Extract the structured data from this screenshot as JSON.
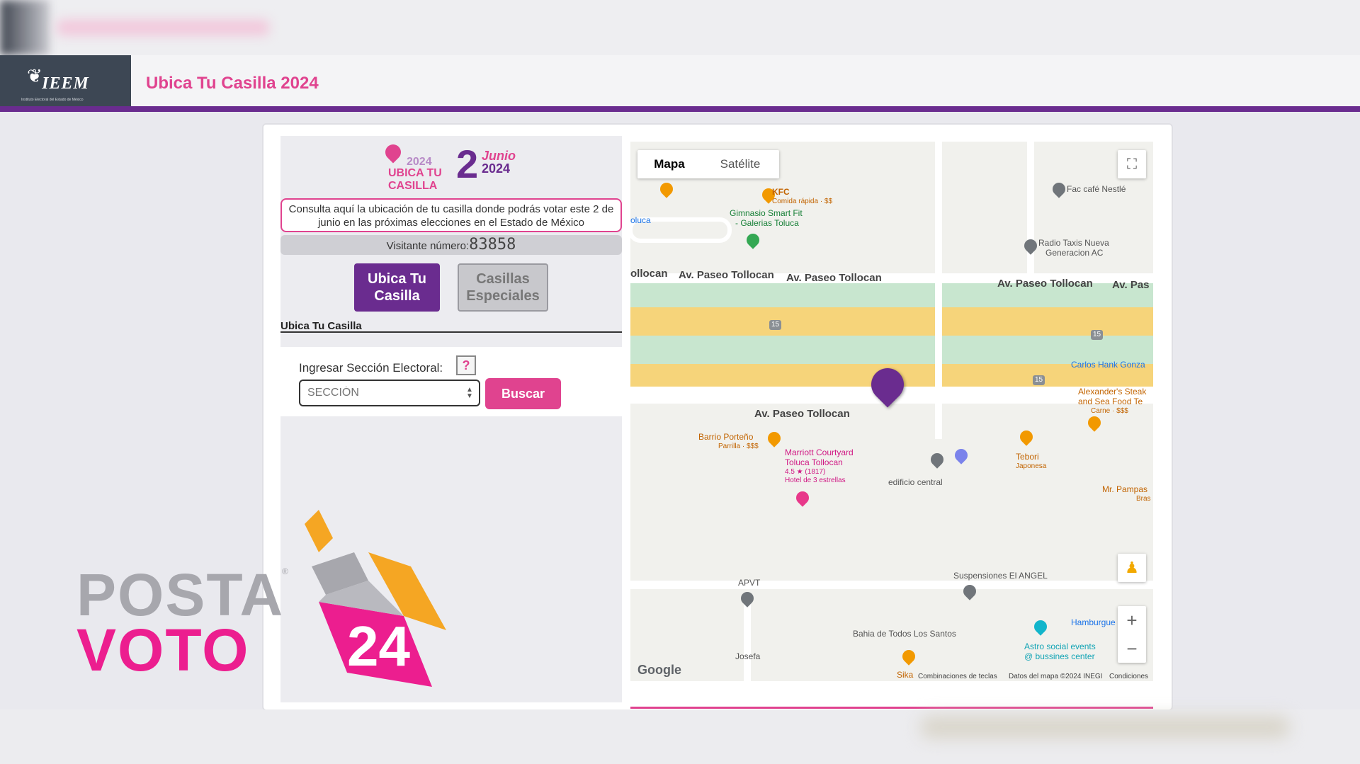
{
  "header": {
    "logo_text": "IEEM",
    "logo_subtitle": "Instituto Electoral del Estado de México",
    "title": "Ubica Tu Casilla 2024"
  },
  "brand": {
    "year": "2024",
    "line1": "UBICA TU",
    "line2": "CASILLA",
    "big_number": "2",
    "month": "Junio",
    "year2": "2024"
  },
  "info": {
    "text": "Consulta aquí la ubicación de tu casilla donde podrás votar este 2 de junio en las próximas elecciones en el Estado de México",
    "visitor_label": "Visitante número:",
    "visitor_count": "83858"
  },
  "buttons": {
    "ubica": "Ubica Tu Casilla",
    "especiales": "Casillas Especiales",
    "buscar": "Buscar"
  },
  "form": {
    "section_title": "Ubica Tu Casilla",
    "label": "Ingresar Sección Electoral:",
    "help": "?",
    "placeholder": "SECCIÓN"
  },
  "overlay": {
    "posta": "POSTA",
    "voto": "VOTO",
    "cube_text": "24",
    "reg": "®"
  },
  "map": {
    "tab_map": "Mapa",
    "tab_satellite": "Satélite",
    "roads": [
      "ollocan",
      "Av. Paseo Tollocan",
      "Av. Paseo Tollocan",
      "Av. Paseo Tollocan",
      "Av. Pas",
      "Av. Paseo Tollocan"
    ],
    "labels": {
      "kfc": "KFC",
      "kfc_sub": "Comida rápida · $$",
      "gym1": "Gimnasio Smart Fit",
      "gym2": "- Galerias Toluca",
      "fac_cafe": "Fac café Nestlé",
      "radio1": "Radio Taxis Nueva",
      "radio2": "Generacion AC",
      "carlos": "Carlos Hank Gonza",
      "alex1": "Alexander's Steak",
      "alex2": "and Sea Food Te",
      "alex3": "Carne · $$$",
      "barrio1": "Barrio Porteño",
      "barrio2": "Parrilla · $$$",
      "marriott1": "Marriott Courtyard",
      "marriott2": "Toluca Tollocan",
      "marriott3": "4.5 ★ (1817)",
      "marriott4": "Hotel de 3 estrellas",
      "edificio": "edificio central",
      "tebori1": "Tebori",
      "tebori2": "Japonesa",
      "pampas1": "Mr. Pampas",
      "pampas2": "Bras",
      "apvt": "APVT",
      "susp": "Suspensiones El ANGEL",
      "hamb": "Hamburgue",
      "astro1": "Astro social events",
      "astro2": "@ bussines center",
      "bahia": "Bahia de Todos Los Santos",
      "josefa": "Josefa",
      "sika": "Sika",
      "toluca": "oluca",
      "route15": "15"
    },
    "google": "Google",
    "attrib_keys": "Combinaciones de teclas",
    "attrib_data": "Datos del mapa ©2024 INEGI",
    "attrib_terms": "Condiciones",
    "zoom_in": "+",
    "zoom_out": "−"
  },
  "colors": {
    "brand_purple": "#6a2c8f",
    "brand_pink": "#e0438f",
    "header_dark": "#3d4754"
  }
}
